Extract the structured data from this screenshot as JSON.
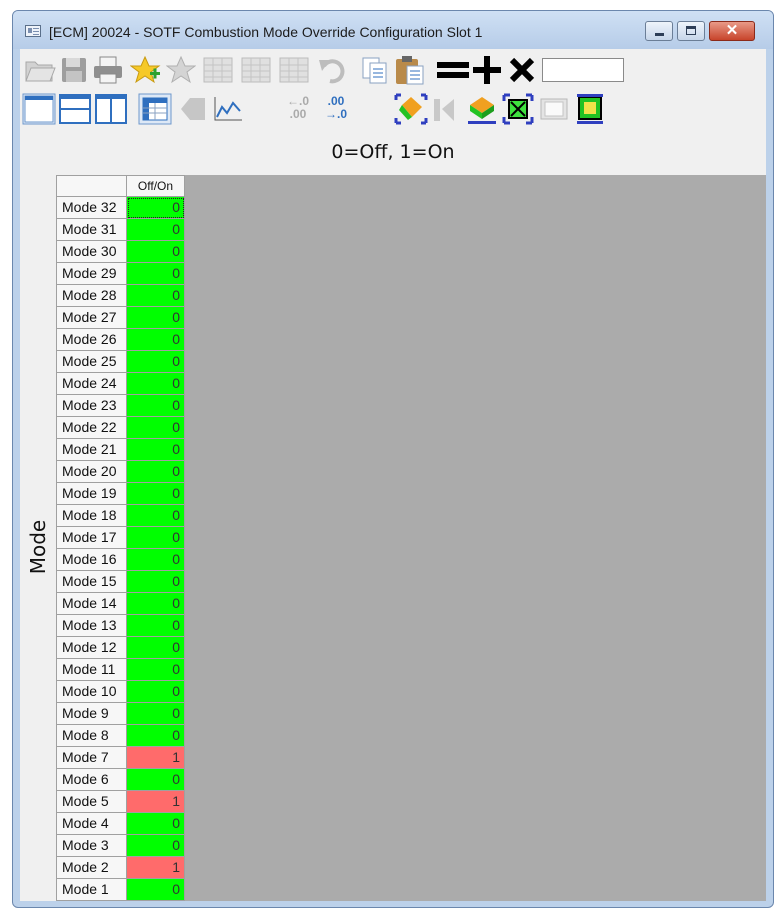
{
  "window": {
    "title": "[ECM] 20024 - SOTF Combustion Mode Override Configuration Slot 1"
  },
  "toolbar1": {
    "value_input": "",
    "icons": [
      "open-folder-icon",
      "save-icon",
      "print-icon",
      "add-favorite-icon",
      "remove-favorite-icon",
      "table-icon",
      "table-columns-icon",
      "table-rows-icon",
      "undo-icon",
      "copy-icon",
      "paste-icon",
      "equals-icon",
      "plus-icon",
      "multiply-icon"
    ]
  },
  "toolbar2": {
    "icons": [
      "layout-top-icon",
      "layout-split-horizontal-icon",
      "layout-split-vertical-icon",
      "table-view-icon",
      "tag-icon",
      "chart-line-icon",
      "decrease-decimals-icon",
      "increase-decimals-icon",
      "color-fill-icon",
      "color-fill-disabled-icon",
      "color-layer-icon",
      "select-cell-icon",
      "border-none-icon",
      "border-box-icon"
    ],
    "decrease_decimals": {
      "top": "←.0",
      "bottom": ".00"
    },
    "increase_decimals": {
      "top": ".00",
      "bottom": "→.0"
    }
  },
  "caption": "0=Off, 1=On",
  "axis_label": "Mode",
  "column_header": "Off/On",
  "colors": {
    "on": "#ff6b6b",
    "off": "#00ff00",
    "grid_bg": "#ababab"
  },
  "rows": [
    {
      "label": "Mode 32",
      "value": "0"
    },
    {
      "label": "Mode 31",
      "value": "0"
    },
    {
      "label": "Mode 30",
      "value": "0"
    },
    {
      "label": "Mode 29",
      "value": "0"
    },
    {
      "label": "Mode 28",
      "value": "0"
    },
    {
      "label": "Mode 27",
      "value": "0"
    },
    {
      "label": "Mode 26",
      "value": "0"
    },
    {
      "label": "Mode 25",
      "value": "0"
    },
    {
      "label": "Mode 24",
      "value": "0"
    },
    {
      "label": "Mode 23",
      "value": "0"
    },
    {
      "label": "Mode 22",
      "value": "0"
    },
    {
      "label": "Mode 21",
      "value": "0"
    },
    {
      "label": "Mode 20",
      "value": "0"
    },
    {
      "label": "Mode 19",
      "value": "0"
    },
    {
      "label": "Mode 18",
      "value": "0"
    },
    {
      "label": "Mode 17",
      "value": "0"
    },
    {
      "label": "Mode 16",
      "value": "0"
    },
    {
      "label": "Mode 15",
      "value": "0"
    },
    {
      "label": "Mode 14",
      "value": "0"
    },
    {
      "label": "Mode 13",
      "value": "0"
    },
    {
      "label": "Mode 12",
      "value": "0"
    },
    {
      "label": "Mode 11",
      "value": "0"
    },
    {
      "label": "Mode 10",
      "value": "0"
    },
    {
      "label": "Mode 9",
      "value": "0"
    },
    {
      "label": "Mode 8",
      "value": "0"
    },
    {
      "label": "Mode 7",
      "value": "1"
    },
    {
      "label": "Mode 6",
      "value": "0"
    },
    {
      "label": "Mode 5",
      "value": "1"
    },
    {
      "label": "Mode 4",
      "value": "0"
    },
    {
      "label": "Mode 3",
      "value": "0"
    },
    {
      "label": "Mode 2",
      "value": "1"
    },
    {
      "label": "Mode 1",
      "value": "0"
    }
  ]
}
